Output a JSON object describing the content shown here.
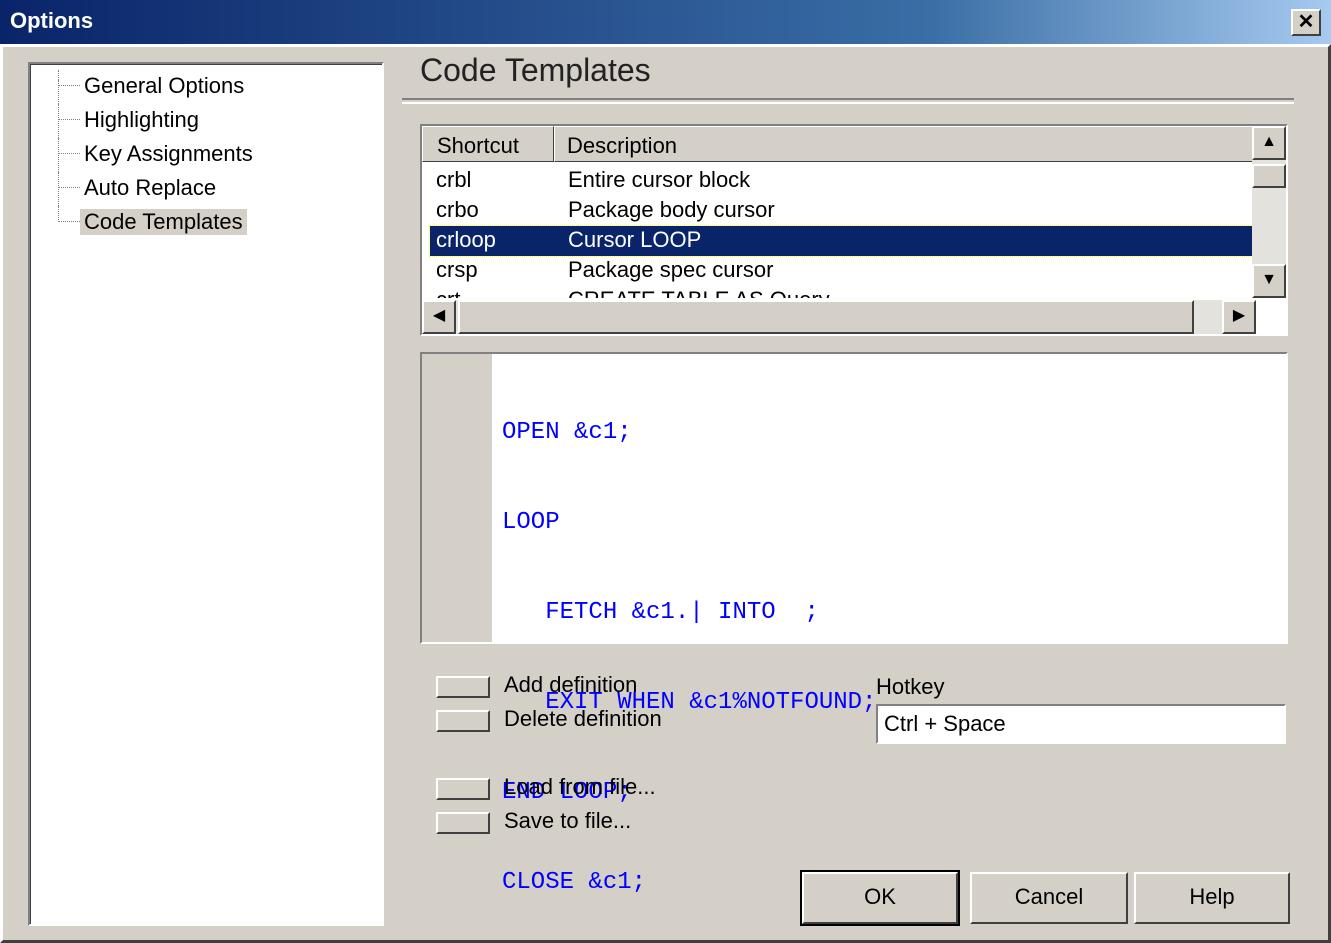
{
  "window": {
    "title": "Options",
    "close_glyph": "✕"
  },
  "tree": {
    "items": [
      {
        "label": "General Options"
      },
      {
        "label": "Highlighting"
      },
      {
        "label": "Key Assignments"
      },
      {
        "label": "Auto Replace"
      },
      {
        "label": "Code Templates",
        "selected": true
      }
    ]
  },
  "section": {
    "title": "Code Templates"
  },
  "listview": {
    "columns": [
      "Shortcut",
      "Description"
    ],
    "rows": [
      {
        "shortcut": "crbl",
        "description": "Entire cursor block"
      },
      {
        "shortcut": "crbo",
        "description": "Package body cursor"
      },
      {
        "shortcut": "crloop",
        "description": "Cursor LOOP",
        "selected": true
      },
      {
        "shortcut": "crsp",
        "description": "Package spec cursor"
      },
      {
        "shortcut": "crt",
        "description": "CREATE TABLE AS Query"
      }
    ],
    "scroll_icons": {
      "up": "up-arrow-icon",
      "down": "down-arrow-icon",
      "left": "left-arrow-icon",
      "right": "right-arrow-icon"
    }
  },
  "editor": {
    "lines": [
      "OPEN &c1;",
      "LOOP",
      "   FETCH &c1.| INTO  ;",
      "   EXIT WHEN &c1%NOTFOUND;",
      "END LOOP;",
      "CLOSE &c1;"
    ],
    "text_color": "#0000ff"
  },
  "actions": {
    "add": "Add definition",
    "delete": "Delete definition",
    "load": "Load from file...",
    "save": "Save to file..."
  },
  "hotkey": {
    "label": "Hotkey",
    "value": "Ctrl + Space"
  },
  "buttons": {
    "ok": "OK",
    "cancel": "Cancel",
    "help": "Help"
  },
  "colors": {
    "face": "#d4d0c8",
    "selection": "#0a246a",
    "title_start": "#0a246a",
    "title_end": "#a6caf0"
  }
}
